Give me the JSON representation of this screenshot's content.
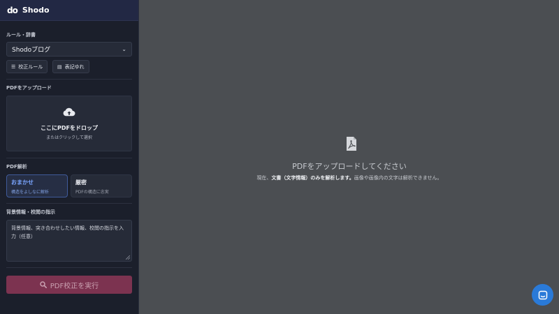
{
  "app": {
    "logo_text": "do",
    "name": "Shodo"
  },
  "rules": {
    "section_label": "ルール・辞書",
    "select_value": "Shodoブログ",
    "chip_rules_label": "校正ルール",
    "chip_dict_label": "表記ゆれ"
  },
  "upload": {
    "section_label": "PDFをアップロード",
    "drop_title": "ここにPDFをドロップ",
    "drop_sub": "またはクリックして選択"
  },
  "analysis": {
    "section_label": "PDF解析",
    "modes": [
      {
        "title": "おまかせ",
        "desc": "構造をよしなに解析",
        "active": true
      },
      {
        "title": "厳密",
        "desc": "PDFの構造に忠実",
        "active": false
      }
    ]
  },
  "instructions": {
    "section_label": "背景情報・校閲の指示",
    "placeholder": "背景情報、突き合わせしたい情報、校閲の指示を入力（任意）"
  },
  "run_button": {
    "label": "PDF校正を実行"
  },
  "main": {
    "title": "PDFをアップロードしてください",
    "sub_before": "現在、",
    "sub_bold": "文書（文字情報）のみを解析します。",
    "sub_after": "画像や画像内の文字は解析できません。"
  },
  "colors": {
    "accent_blue": "#7aa5ff",
    "run_button": "#7c3350",
    "chat_button": "#2a7ad8"
  },
  "icons": [
    "cloud-upload-icon",
    "pdf-file-icon",
    "search-icon",
    "list-icon",
    "book-icon",
    "chevron-down-icon",
    "chat-icon"
  ]
}
